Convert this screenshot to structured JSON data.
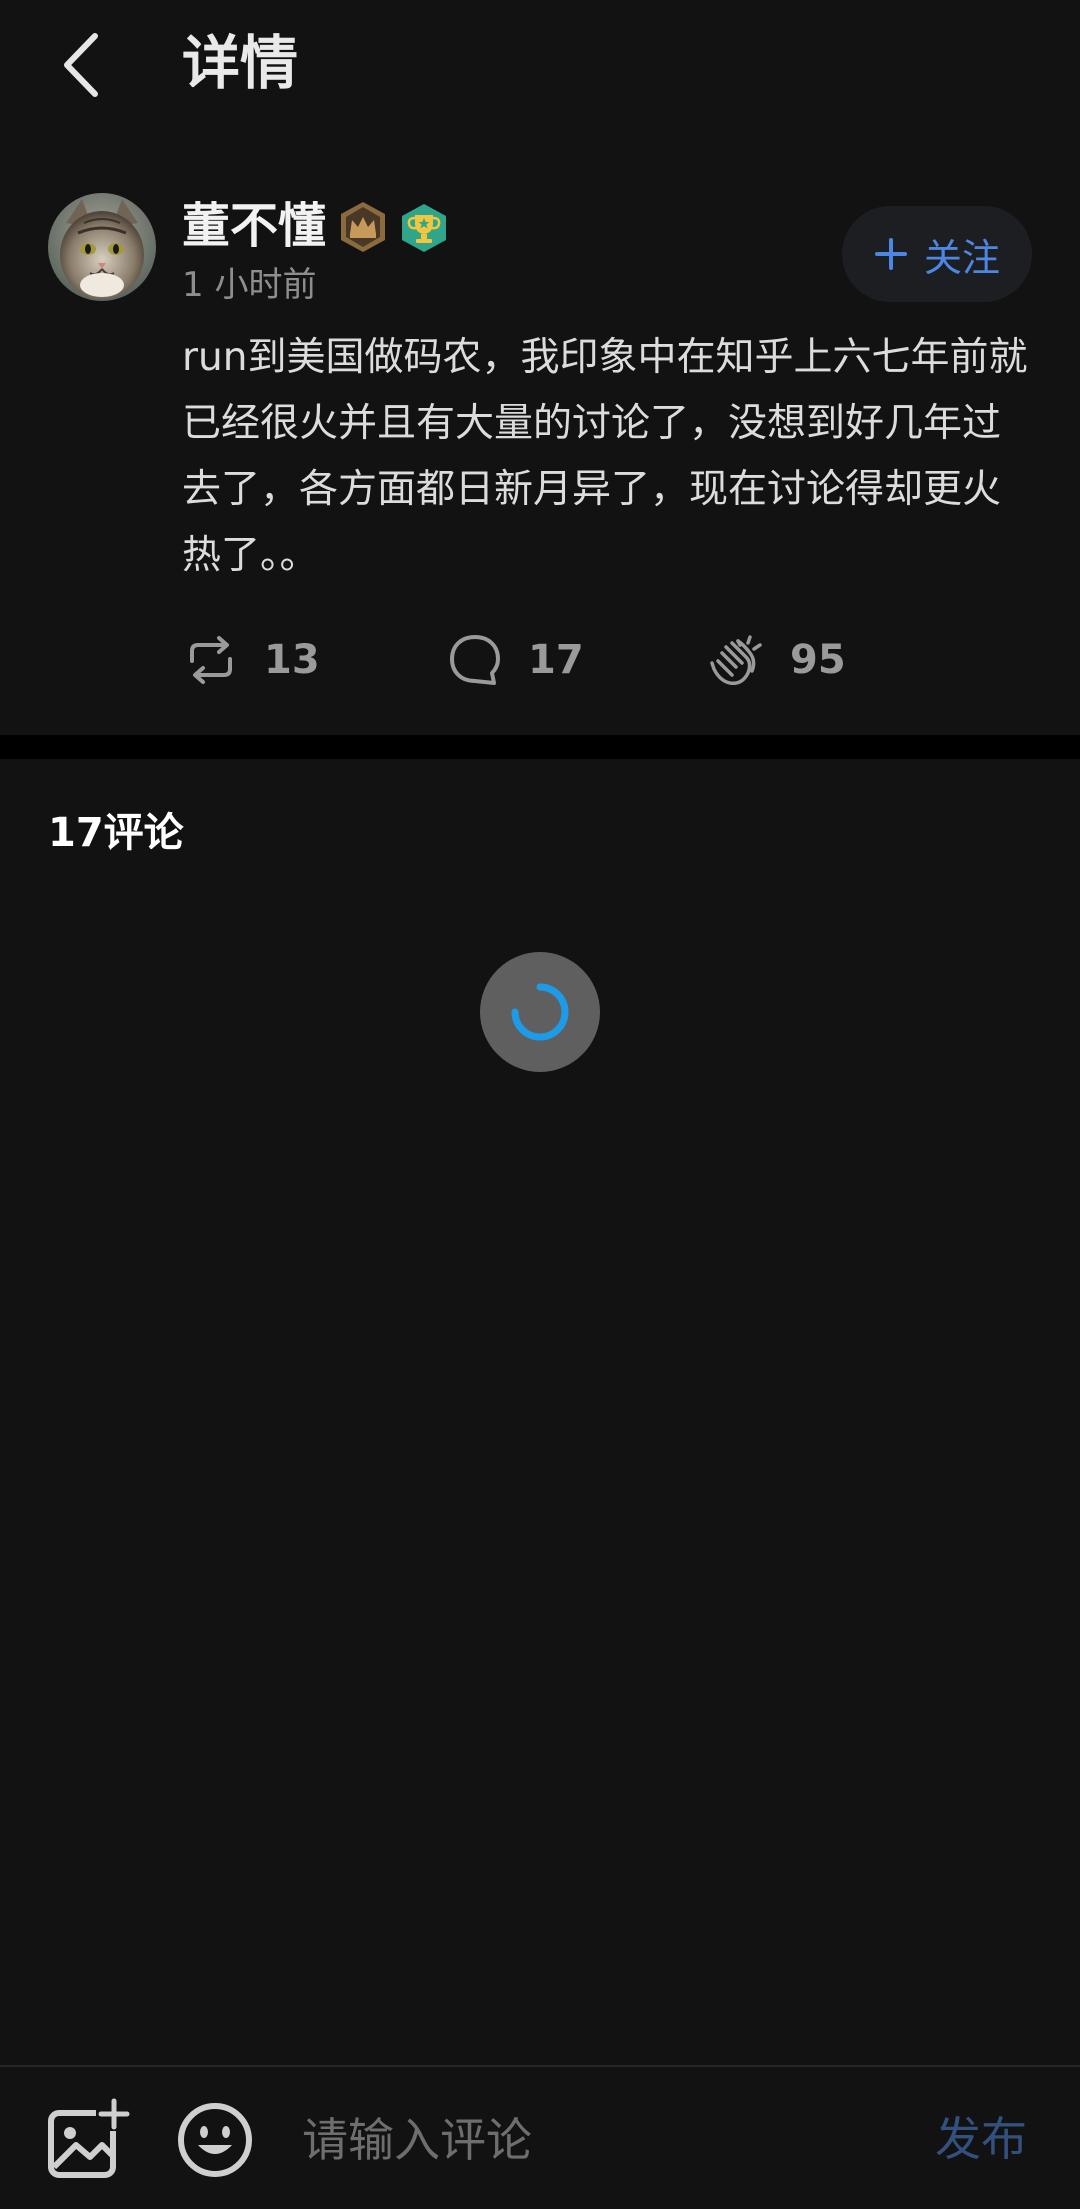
{
  "header": {
    "title": "详情",
    "back_icon": "chevron-left-icon"
  },
  "post": {
    "author": {
      "name": "董不懂",
      "badges": [
        "crown-badge-icon",
        "trophy-badge-icon"
      ]
    },
    "time": "1 小时前",
    "follow_label": "关注",
    "content": "run到美国做码农，我印象中在知乎上六七年前就已经很火并且有大量的讨论了，没想到好几年过去了，各方面都日新月异了，现在讨论得却更火热了。。",
    "stats": {
      "reposts": "13",
      "comments": "17",
      "claps": "95"
    }
  },
  "comments": {
    "title": "17评论"
  },
  "bottom_bar": {
    "input_placeholder": "请输入评论",
    "publish_label": "发布"
  },
  "colors": {
    "background": "#121212",
    "accent": "#4d86e3",
    "publish_disabled": "#33517f",
    "spinner": "#1e9be8"
  }
}
